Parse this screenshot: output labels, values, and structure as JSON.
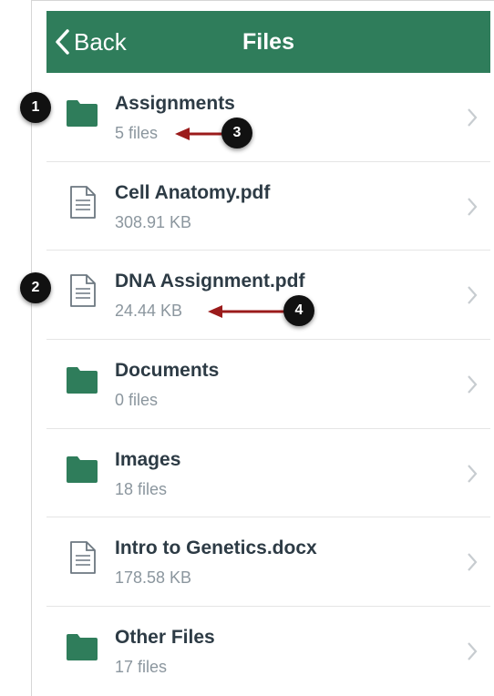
{
  "navbar": {
    "back_label": "Back",
    "title": "Files",
    "color": "#2f7d5b"
  },
  "items": [
    {
      "type": "folder",
      "icon": "folder-icon",
      "name": "Assignments",
      "meta": "5 files"
    },
    {
      "type": "file",
      "icon": "document-icon",
      "name": "Cell Anatomy.pdf",
      "meta": "308.91 KB"
    },
    {
      "type": "file",
      "icon": "document-icon",
      "name": "DNA Assignment.pdf",
      "meta": "24.44 KB"
    },
    {
      "type": "folder",
      "icon": "folder-icon",
      "name": "Documents",
      "meta": "0 files"
    },
    {
      "type": "folder",
      "icon": "folder-icon",
      "name": "Images",
      "meta": "18 files"
    },
    {
      "type": "file",
      "icon": "document-icon",
      "name": "Intro to Genetics.docx",
      "meta": "178.58 KB"
    },
    {
      "type": "folder",
      "icon": "folder-icon",
      "name": "Other Files",
      "meta": "17 files"
    }
  ],
  "callouts": [
    "1",
    "2",
    "3",
    "4"
  ],
  "colors": {
    "folder": "#2f7d5b",
    "arrow": "#9b1b1b",
    "callout": "#111111"
  }
}
